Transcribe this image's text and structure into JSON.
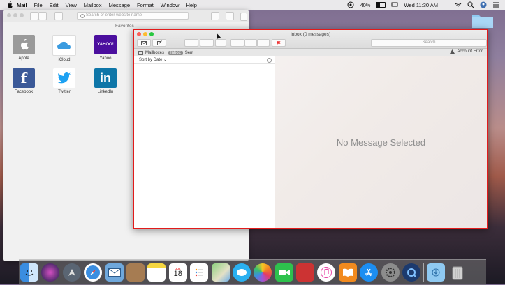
{
  "menubar": {
    "app": "Mail",
    "items": [
      "File",
      "Edit",
      "View",
      "Mailbox",
      "Message",
      "Format",
      "Window",
      "Help"
    ],
    "battery": "40%",
    "clock": "Wed 11:30 AM"
  },
  "safari": {
    "address_placeholder": "Search or enter website name",
    "favorites_title": "Favorites",
    "tiles": [
      {
        "label": "Apple",
        "color": "#9a9a9a"
      },
      {
        "label": "iCloud",
        "color": "#3a9be0"
      },
      {
        "label": "Yahoo",
        "color": "#4b0f9e",
        "text": "YAHOO!"
      },
      {
        "label": "Facebook",
        "color": "#3b5998",
        "text": "f"
      },
      {
        "label": "Twitter",
        "color": "#1da1f2"
      },
      {
        "label": "LinkedIn",
        "color": "#0e76a8",
        "text": "in"
      }
    ]
  },
  "mail": {
    "title": "Inbox (0 messages)",
    "search_placeholder": "Search",
    "favorites": {
      "mailboxes": "Mailboxes",
      "inbox": "Inbox",
      "sent": "Sent"
    },
    "account_status": "Account Error",
    "sort_label": "Sort by Date",
    "viewer_text": "No Message Selected",
    "highlight_color": "#e21b1b"
  },
  "dock": {
    "calendar_month": "JUL",
    "calendar_day": "18"
  }
}
